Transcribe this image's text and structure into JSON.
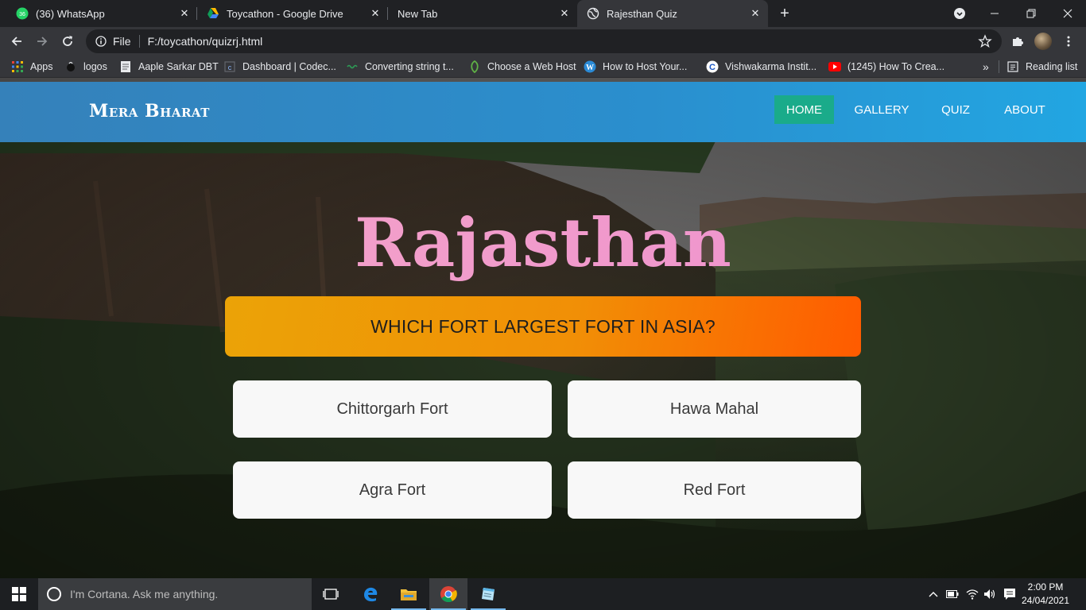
{
  "browser": {
    "tabs": [
      {
        "title": "(36) WhatsApp",
        "badge": "36",
        "icon": "whatsapp-icon"
      },
      {
        "title": "Toycathon - Google Drive",
        "icon": "google-drive-icon"
      },
      {
        "title": "New Tab",
        "icon": ""
      },
      {
        "title": "Rajesthan Quiz",
        "icon": "globe-icon",
        "active": true
      }
    ],
    "address": {
      "scheme_label": "File",
      "url": "F:/toycathon/quizrj.html"
    },
    "bookmarks": [
      {
        "label": "Apps",
        "icon": "apps-grid-icon"
      },
      {
        "label": "logos",
        "icon": "logo-icon"
      },
      {
        "label": "Aaple Sarkar DBT",
        "icon": "document-icon"
      },
      {
        "label": "Dashboard | Codec...",
        "icon": "codec-icon"
      },
      {
        "label": "Converting string t...",
        "icon": "code-icon"
      },
      {
        "label": "Choose a Web Host",
        "icon": "leaf-icon"
      },
      {
        "label": "How to Host Your...",
        "icon": "wordpress-icon"
      },
      {
        "label": "Vishwakarma Instit...",
        "icon": "c-logo-icon"
      },
      {
        "label": "(1245) How To Crea...",
        "icon": "youtube-icon"
      }
    ],
    "overflow_label": "»",
    "reading_list": "Reading list"
  },
  "site": {
    "brand": "Mera Bharat",
    "nav": [
      {
        "label": "HOME",
        "active": true
      },
      {
        "label": "GALLERY"
      },
      {
        "label": "QUIZ"
      },
      {
        "label": "ABOUT"
      }
    ],
    "accent_color": "#1aab8a"
  },
  "quiz": {
    "title": "Rajasthan",
    "question": "WHICH FORT LARGEST FORT IN ASIA?",
    "options": [
      "Chittorgarh Fort",
      "Hawa Mahal",
      "Agra Fort",
      "Red Fort"
    ]
  },
  "taskbar": {
    "search_placeholder": "I'm Cortana. Ask me anything.",
    "time": "2:00 PM",
    "date": "24/04/2021"
  }
}
